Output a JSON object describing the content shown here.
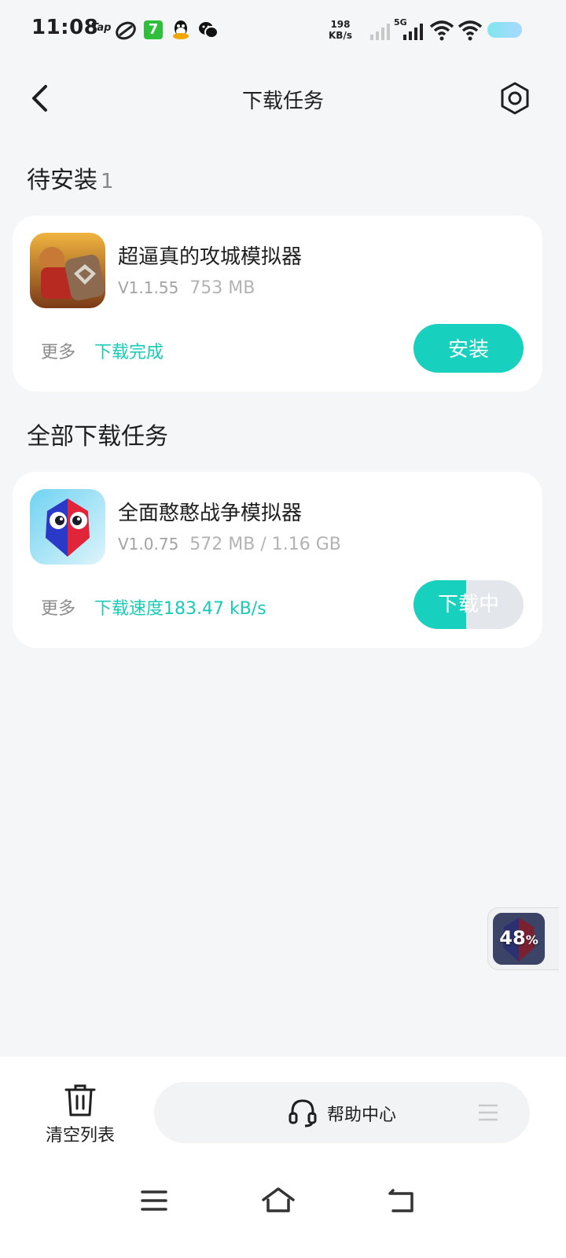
{
  "status_bar": {
    "time": "11:08",
    "tap_label": "Tap",
    "seven_label": "7",
    "net_speed_value": "198",
    "net_speed_unit": "KB/s",
    "network": "5G"
  },
  "header": {
    "title": "下载任务"
  },
  "pending": {
    "title": "待安装",
    "count": "1",
    "item": {
      "name": "超逼真的攻城模拟器",
      "version": "V1.1.55",
      "size": "753 MB",
      "more_label": "更多",
      "status": "下载完成",
      "action_label": "安装"
    }
  },
  "all": {
    "title": "全部下载任务",
    "item": {
      "name": "全面憨憨战争模拟器",
      "version": "V1.0.75",
      "size": "572 MB / 1.16 GB",
      "more_label": "更多",
      "status": "下载速度183.47 kB/s",
      "action_label": "下载中",
      "progress": 0.48
    }
  },
  "floating": {
    "percent": "48",
    "percent_sign": "%"
  },
  "bottom": {
    "clear_label": "清空列表",
    "help_label": "帮助中心"
  },
  "colors": {
    "accent": "#17d0bd",
    "accent_text": "#17cbb7",
    "background": "#f5f6f8"
  }
}
